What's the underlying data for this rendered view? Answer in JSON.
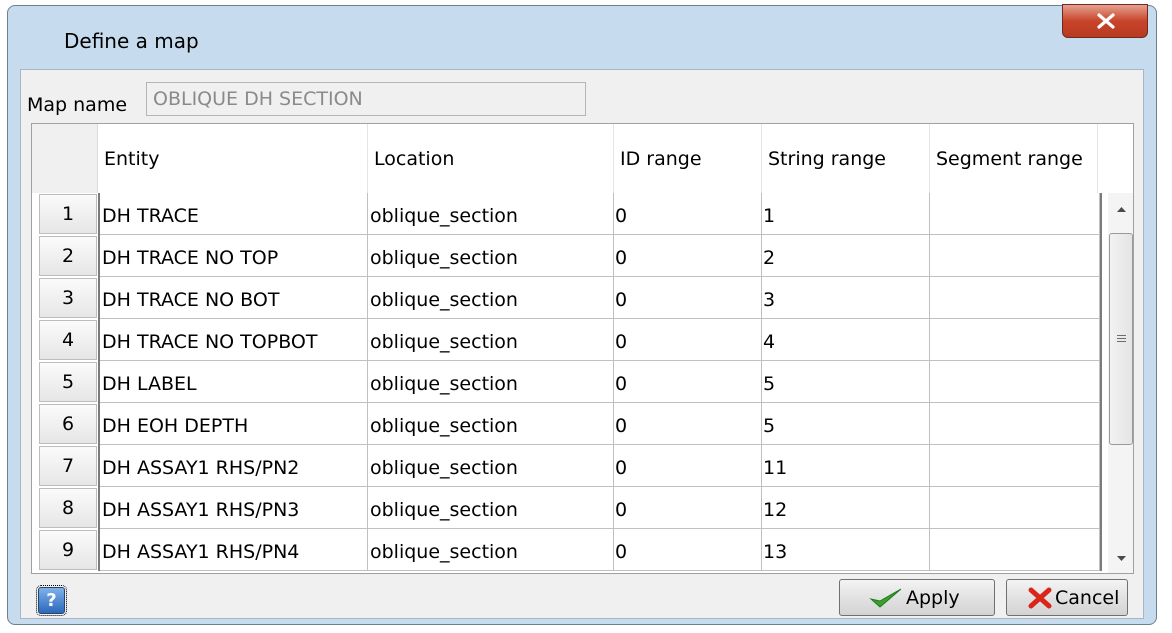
{
  "window": {
    "title": "Define a map",
    "close_icon": "close-icon"
  },
  "mapname": {
    "label": "Map name",
    "value": "OBLIQUE DH SECTION"
  },
  "columns": [
    "Entity",
    "Location",
    "ID range",
    "String range",
    "Segment range"
  ],
  "rows": [
    {
      "n": "1",
      "entity": "DH TRACE",
      "location": "oblique_section",
      "id": "0",
      "string": "1",
      "segment": ""
    },
    {
      "n": "2",
      "entity": "DH TRACE NO TOP",
      "location": "oblique_section",
      "id": "0",
      "string": "2",
      "segment": ""
    },
    {
      "n": "3",
      "entity": "DH TRACE NO BOT",
      "location": "oblique_section",
      "id": "0",
      "string": "3",
      "segment": ""
    },
    {
      "n": "4",
      "entity": "DH TRACE NO TOPBOT",
      "location": "oblique_section",
      "id": "0",
      "string": "4",
      "segment": ""
    },
    {
      "n": "5",
      "entity": "DH LABEL",
      "location": "oblique_section",
      "id": "0",
      "string": "5",
      "segment": ""
    },
    {
      "n": "6",
      "entity": "DH EOH DEPTH",
      "location": "oblique_section",
      "id": "0",
      "string": "5",
      "segment": ""
    },
    {
      "n": "7",
      "entity": "DH ASSAY1 RHS/PN2",
      "location": "oblique_section",
      "id": "0",
      "string": "11",
      "segment": ""
    },
    {
      "n": "8",
      "entity": "DH ASSAY1 RHS/PN3",
      "location": "oblique_section",
      "id": "0",
      "string": "12",
      "segment": ""
    },
    {
      "n": "9",
      "entity": "DH ASSAY1 RHS/PN4",
      "location": "oblique_section",
      "id": "0",
      "string": "13",
      "segment": ""
    }
  ],
  "buttons": {
    "help": "?",
    "apply": "Apply",
    "cancel": "Cancel"
  },
  "colors": {
    "title_bar": "#c7dbee",
    "close_button": "#c7442a",
    "apply_check": "#3aa12e",
    "cancel_x": "#d8261c"
  }
}
